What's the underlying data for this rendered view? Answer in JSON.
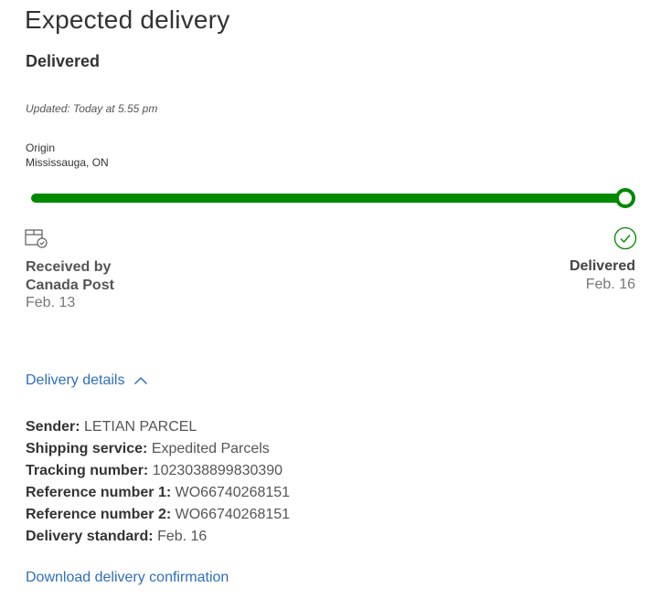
{
  "heading": "Expected delivery",
  "status": "Delivered",
  "updated": "Updated: Today at 5.55 pm",
  "origin": {
    "label": "Origin",
    "value": "Mississauga, ON"
  },
  "progress": {
    "fraction": 1.0,
    "color": "#008a00"
  },
  "milestones": {
    "received": {
      "title": "Received by Canada Post",
      "date": "Feb. 13",
      "icon": "package-icon"
    },
    "delivered": {
      "title": "Delivered",
      "date": "Feb. 16",
      "icon": "check-circle-icon"
    }
  },
  "details": {
    "toggle_label": "Delivery details",
    "toggle_icon": "chevron-up-icon",
    "rows": [
      {
        "label": "Sender:",
        "value": "LETIAN PARCEL"
      },
      {
        "label": "Shipping service:",
        "value": "Expedited Parcels"
      },
      {
        "label": "Tracking number:",
        "value": "1023038899830390"
      },
      {
        "label": "Reference number 1:",
        "value": "WO66740268151"
      },
      {
        "label": "Reference number 2:",
        "value": "WO66740268151"
      },
      {
        "label": "Delivery standard:",
        "value": "Feb. 16"
      }
    ]
  },
  "download_link": "Download delivery confirmation",
  "colors": {
    "accent_link": "#2f6fba",
    "success": "#008a00"
  }
}
